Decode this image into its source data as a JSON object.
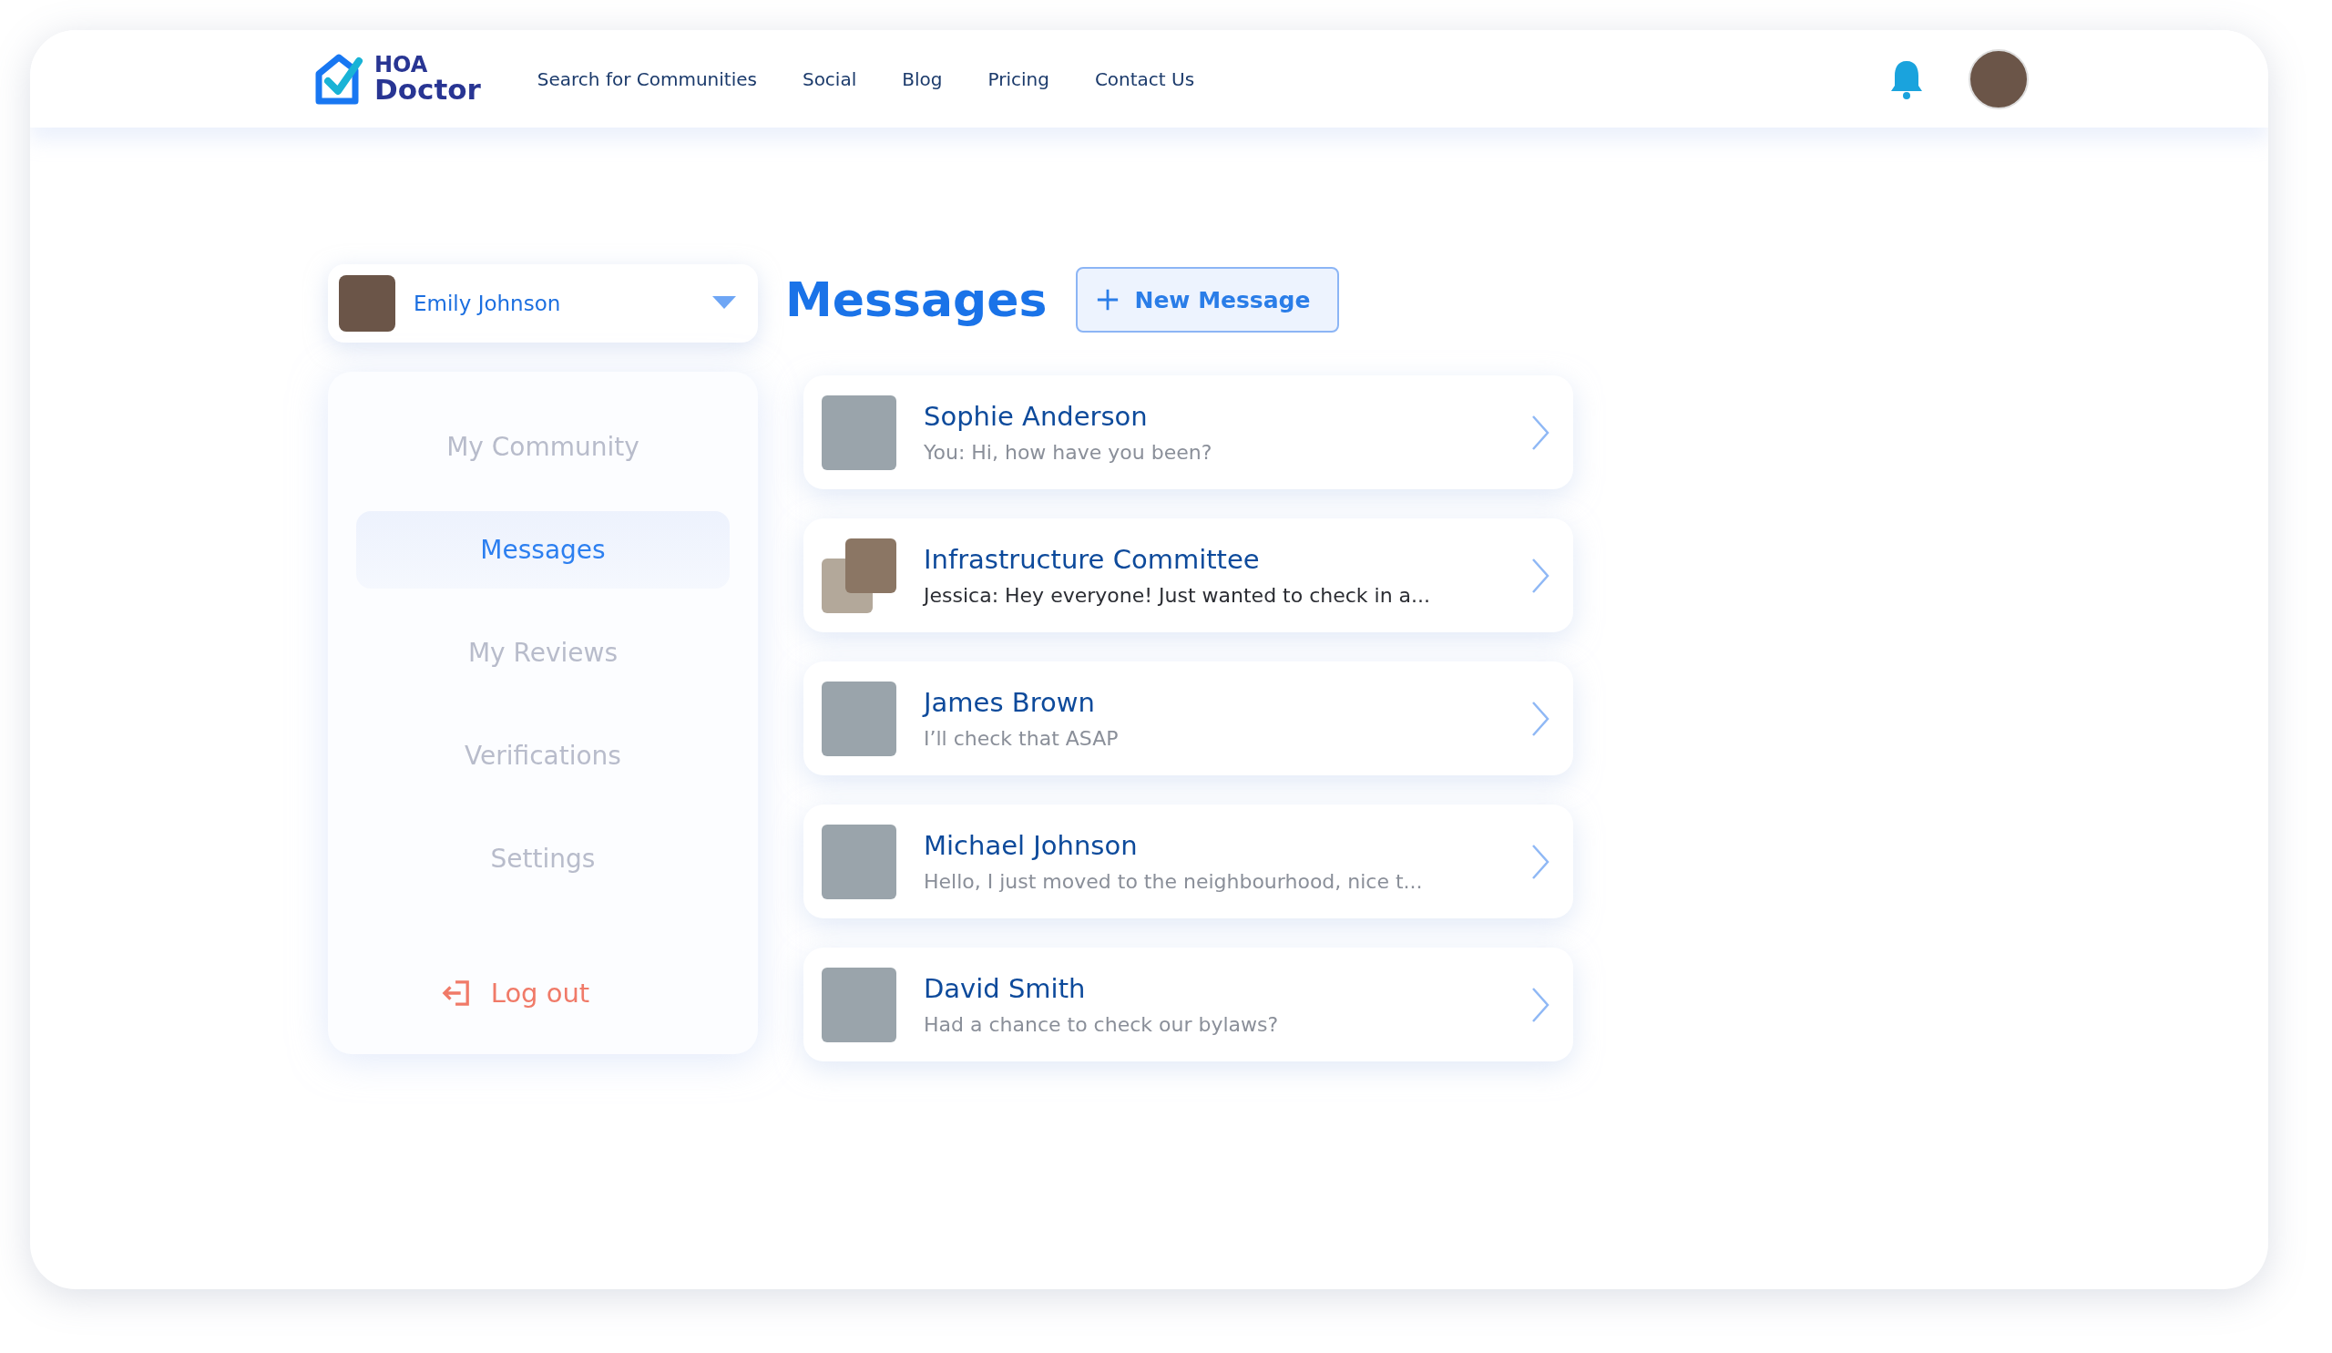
{
  "header": {
    "logo": {
      "line_1": "HOA",
      "line_2": "Doctor"
    },
    "nav": [
      "Search for Communities",
      "Social",
      "Blog",
      "Pricing",
      "Contact Us"
    ]
  },
  "account": {
    "name": "Emily Johnson"
  },
  "sidebar": {
    "items": [
      {
        "label": "My Community",
        "selected": false
      },
      {
        "label": "Messages",
        "selected": true
      },
      {
        "label": "My Reviews",
        "selected": false
      },
      {
        "label": "Verifications",
        "selected": false
      },
      {
        "label": "Settings",
        "selected": false
      }
    ],
    "logout": "Log out"
  },
  "main": {
    "title": "Messages",
    "new_button": "New Message",
    "conversations": [
      {
        "kind": "person",
        "name": "Sophie Anderson",
        "preview": "You: Hi, how have you been?",
        "unread": false
      },
      {
        "kind": "group",
        "name": "Infrastructure Committee",
        "preview": "Jessica: Hey everyone! Just wanted to check in a...",
        "unread": true
      },
      {
        "kind": "person",
        "name": "James Brown",
        "preview": "I’ll check that ASAP",
        "unread": false
      },
      {
        "kind": "person",
        "name": "Michael Johnson",
        "preview": "Hello, I just moved to the neighbourhood, nice t...",
        "unread": false
      },
      {
        "kind": "person",
        "name": "David Smith",
        "preview": "Had a chance to check our bylaws?",
        "unread": false
      }
    ]
  }
}
